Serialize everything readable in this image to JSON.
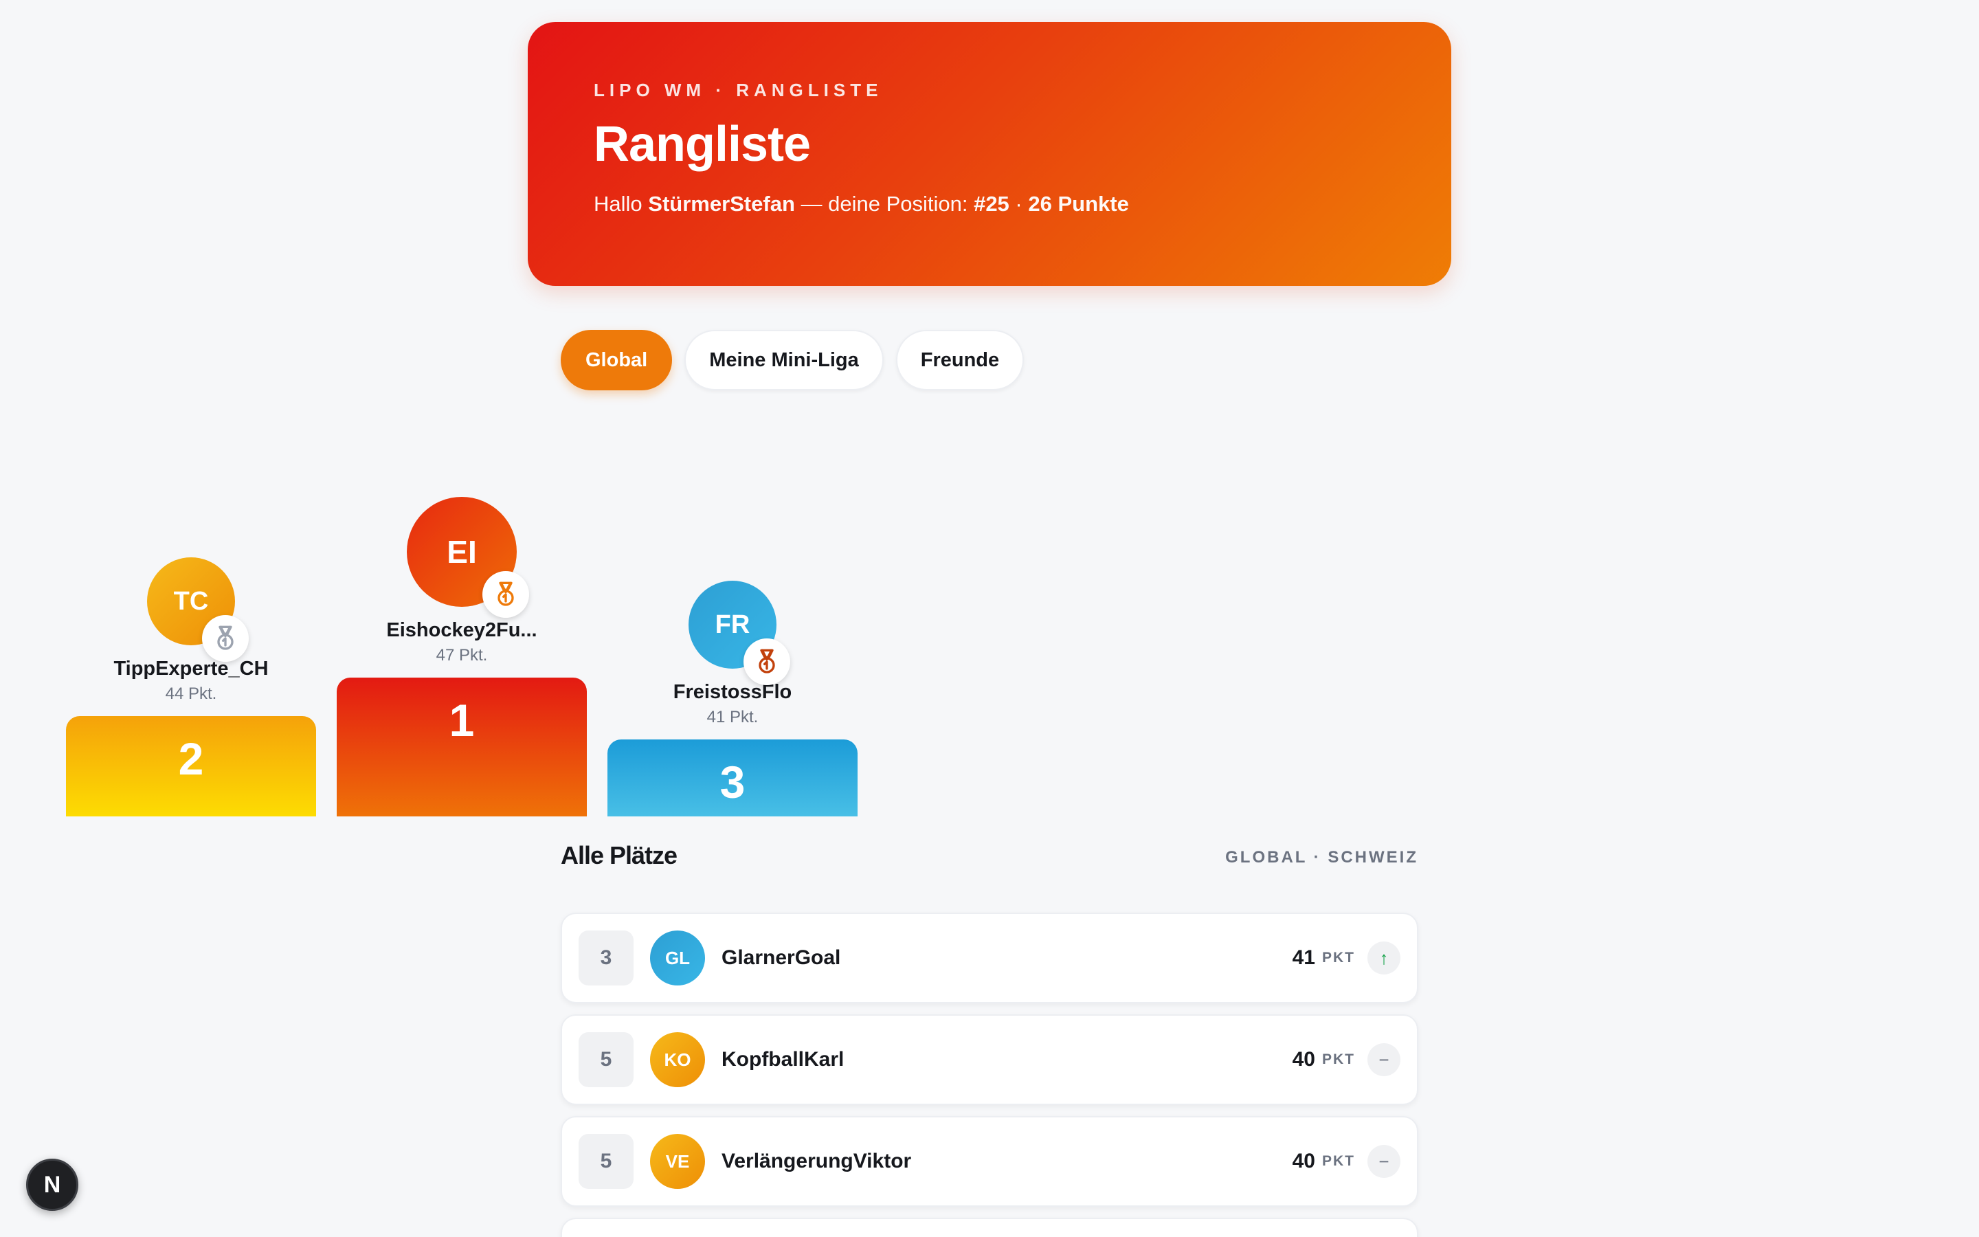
{
  "header": {
    "eyebrow": "LIPO WM · RANGLISTE",
    "title": "Rangliste",
    "greeting_prefix": "Hallo ",
    "username": "StürmerStefan",
    "greeting_mid": " — deine Position: ",
    "position": "#25",
    "separator": " · ",
    "points": "26 Punkte"
  },
  "tabs": [
    {
      "label": "Global",
      "active": true
    },
    {
      "label": "Meine Mini-Liga",
      "active": false
    },
    {
      "label": "Freunde",
      "active": false
    }
  ],
  "podium": {
    "second": {
      "initials": "TC",
      "name": "TippExperte_CH",
      "points": "44 Pkt.",
      "place": "2",
      "color": "#f2a90c",
      "medal": "silver-medal-icon"
    },
    "first": {
      "initials": "EI",
      "name": "Eishockey2Fu...",
      "points": "47 Pkt.",
      "place": "1",
      "color": "#e6390e",
      "medal": "gold-medal-icon"
    },
    "third": {
      "initials": "FR",
      "name": "FreistossFlo",
      "points": "41 Pkt.",
      "place": "3",
      "color": "#29a4d9",
      "medal": "bronze-medal-icon"
    }
  },
  "list": {
    "title": "Alle Plätze",
    "scope": "GLOBAL · SCHWEIZ",
    "unit": "PKT",
    "rows": [
      {
        "rank": "3",
        "initials": "GL",
        "name": "GlarnerGoal",
        "points": "41",
        "trend": "↑",
        "color": "#29a4d9"
      },
      {
        "rank": "5",
        "initials": "KO",
        "name": "KopfballKarl",
        "points": "40",
        "trend": "−",
        "color": "#f2a90c"
      },
      {
        "rank": "5",
        "initials": "VE",
        "name": "VerlängerungViktor",
        "points": "40",
        "trend": "−",
        "color": "#f2a90c"
      }
    ]
  },
  "badge": {
    "letter": "N"
  }
}
